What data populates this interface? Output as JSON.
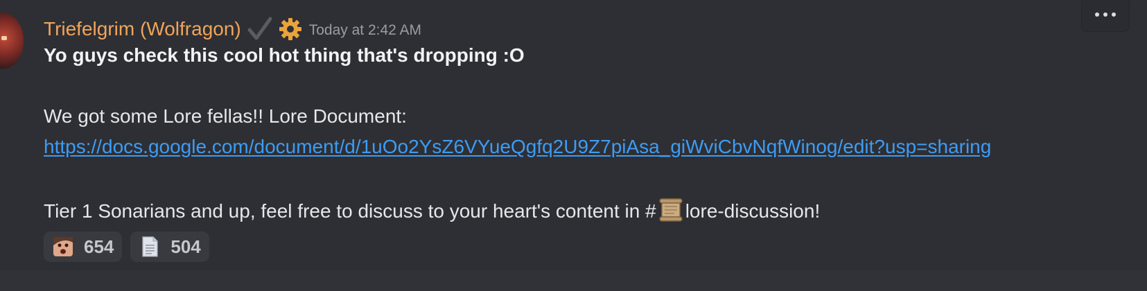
{
  "message": {
    "author": "Triefelgrim (Wolfragon)",
    "timestamp": "Today at 2:42 AM",
    "line1": "Yo guys check this cool hot thing that's dropping :O",
    "line2": "We got some Lore fellas!!  Lore Document:",
    "link": "https://docs.google.com/document/d/1uOo2YsZ6VYueQgfq2U9Z7piAsa_giWviCbvNqfWinog/edit?usp=sharing",
    "line3_prefix": "Tier 1 Sonarians and up, feel free to discuss to your heart's content in #",
    "channel": "lore-discussion",
    "line3_suffix": "!"
  },
  "reactions": [
    {
      "emoji": "face-emoji",
      "count": "654"
    },
    {
      "emoji": "page-emoji",
      "count": "504"
    }
  ],
  "colors": {
    "username": "#f0a55a",
    "link": "#3d9cf5",
    "background": "#2e2f34"
  }
}
